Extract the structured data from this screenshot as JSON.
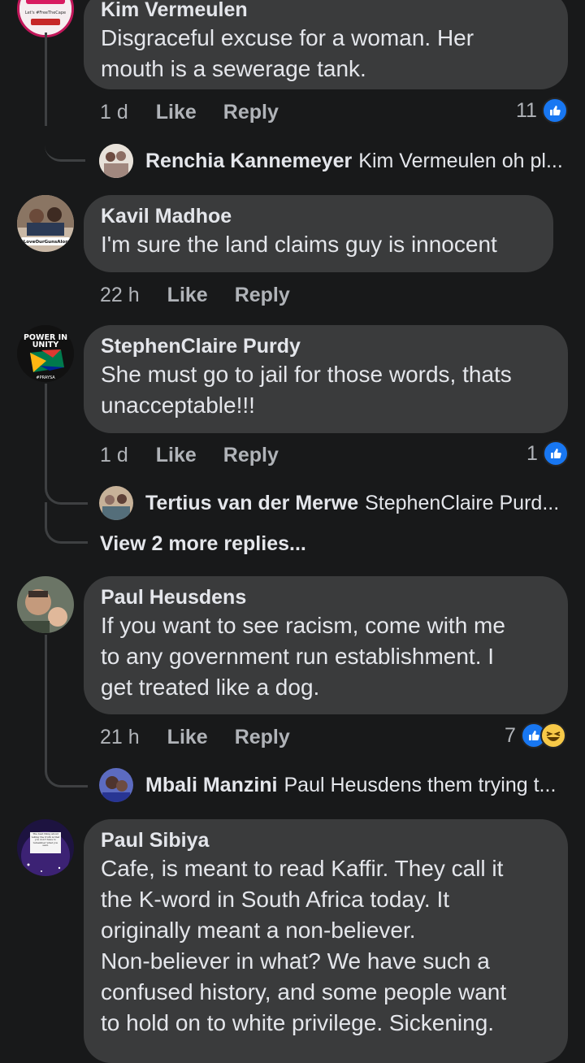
{
  "colors": {
    "background": "#18191a",
    "bubble": "#3a3b3c",
    "meta_text": "#b0b3b8",
    "like_blue": "#1877f2",
    "haha_yellow": "#f7c948"
  },
  "actions": {
    "like": "Like",
    "reply": "Reply"
  },
  "comments": [
    {
      "author": "Kim Vermeulen",
      "lines": [
        "Disgraceful excuse for a woman. Her",
        "mouth is a sewerage tank."
      ],
      "time": "1 d",
      "reaction_count": "11",
      "reactions": [
        "like-icon"
      ],
      "replies": [
        {
          "author": "Renchia Kannemeyer",
          "preview": "Kim Vermeulen oh pl..."
        }
      ]
    },
    {
      "author": "Kavil Madhoe",
      "lines": [
        "I'm sure the land claims guy is innocent"
      ],
      "time": "22 h"
    },
    {
      "author": "StephenClaire Purdy",
      "lines": [
        "She must go to jail for those words, thats",
        "unacceptable!!!"
      ],
      "time": "1 d",
      "reaction_count": "1",
      "reactions": [
        "like-icon"
      ],
      "replies": [
        {
          "author": "Tertius van der Merwe",
          "preview": "StephenClaire Purd..."
        }
      ],
      "view_more": "View 2 more replies..."
    },
    {
      "author": "Paul Heusdens",
      "lines": [
        "If you want to see racism, come with me",
        "to any government run establishment. I",
        "get treated like a dog."
      ],
      "time": "21 h",
      "reaction_count": "7",
      "reactions": [
        "like-icon",
        "haha-icon"
      ],
      "replies": [
        {
          "author": "Mbali Manzini",
          "preview": "Paul Heusdens them trying t..."
        }
      ]
    },
    {
      "author": "Paul Sibiya",
      "lines": [
        "Cafe, is meant to read Kaffir. They call it",
        "the K-word in South Africa today. It",
        "originally meant a non-believer.",
        "Non-believer in what? We have such a",
        "confused history, and some people want",
        "to hold on to white privilege. Sickening."
      ]
    }
  ],
  "avatar_labels": {
    "kim": [
      "Let's #FreeTheCape",
      "#LoveOurGunsAlone"
    ],
    "kavil": "#LoveOurGunsAlone",
    "stephen": [
      "POWER IN",
      "UNITY",
      "#PRAYSA"
    ],
    "sibiya": "The best thing about telling the truth is that you don't have to remember what you said."
  }
}
